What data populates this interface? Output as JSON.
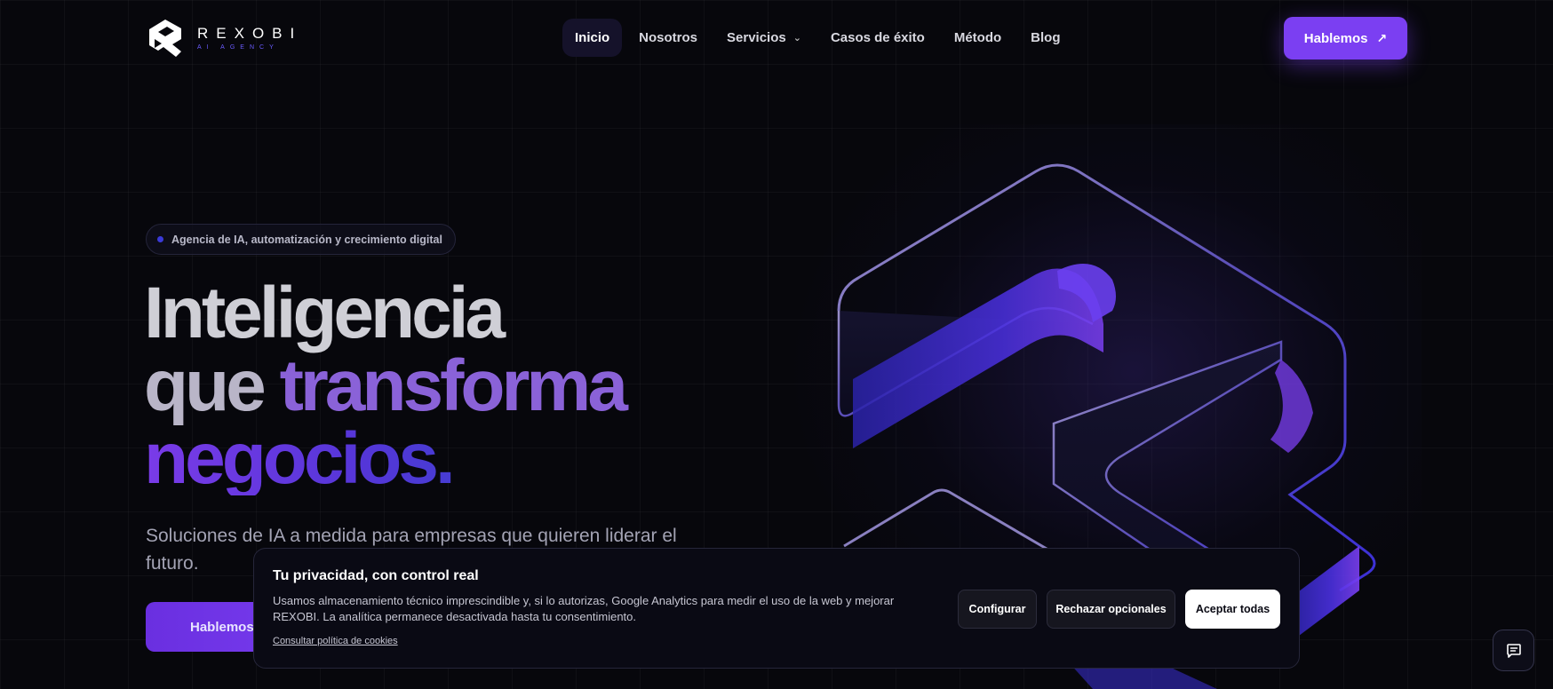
{
  "brand": {
    "name": "REXOBI",
    "tagline": "AI AGENCY",
    "accent": "#7b3ff2"
  },
  "nav": {
    "items": [
      {
        "label": "Inicio",
        "active": true
      },
      {
        "label": "Nosotros"
      },
      {
        "label": "Servicios",
        "has_dropdown": true
      },
      {
        "label": "Casos de éxito"
      },
      {
        "label": "Método"
      },
      {
        "label": "Blog"
      }
    ],
    "cta_label": "Hablemos"
  },
  "hero": {
    "badge": "Agencia de IA, automatización y crecimiento digital",
    "headline_line1": "Inteligencia",
    "headline_word_que": "que",
    "headline_word_transforma": "transforma",
    "headline_line3": "negocios.",
    "subtitle": "Soluciones de IA a medida para empresas que quieren liderar el futuro.",
    "cta_label": "Hablemos"
  },
  "cookie_banner": {
    "title": "Tu privacidad, con control real",
    "text": "Usamos almacenamiento técnico imprescindible y, si lo autorizas, Google Analytics para medir el uso de la web y mejorar REXOBI. La analítica permanece desactivada hasta tu consentimiento.",
    "policy_link": "Consultar política de cookies",
    "buttons": {
      "configure": "Configurar",
      "reject": "Rechazar opcionales",
      "accept": "Aceptar todas"
    }
  },
  "icons": {
    "chat": "chat-icon",
    "arrow": "arrow-up-right-icon",
    "chevron": "chevron-down-icon"
  }
}
